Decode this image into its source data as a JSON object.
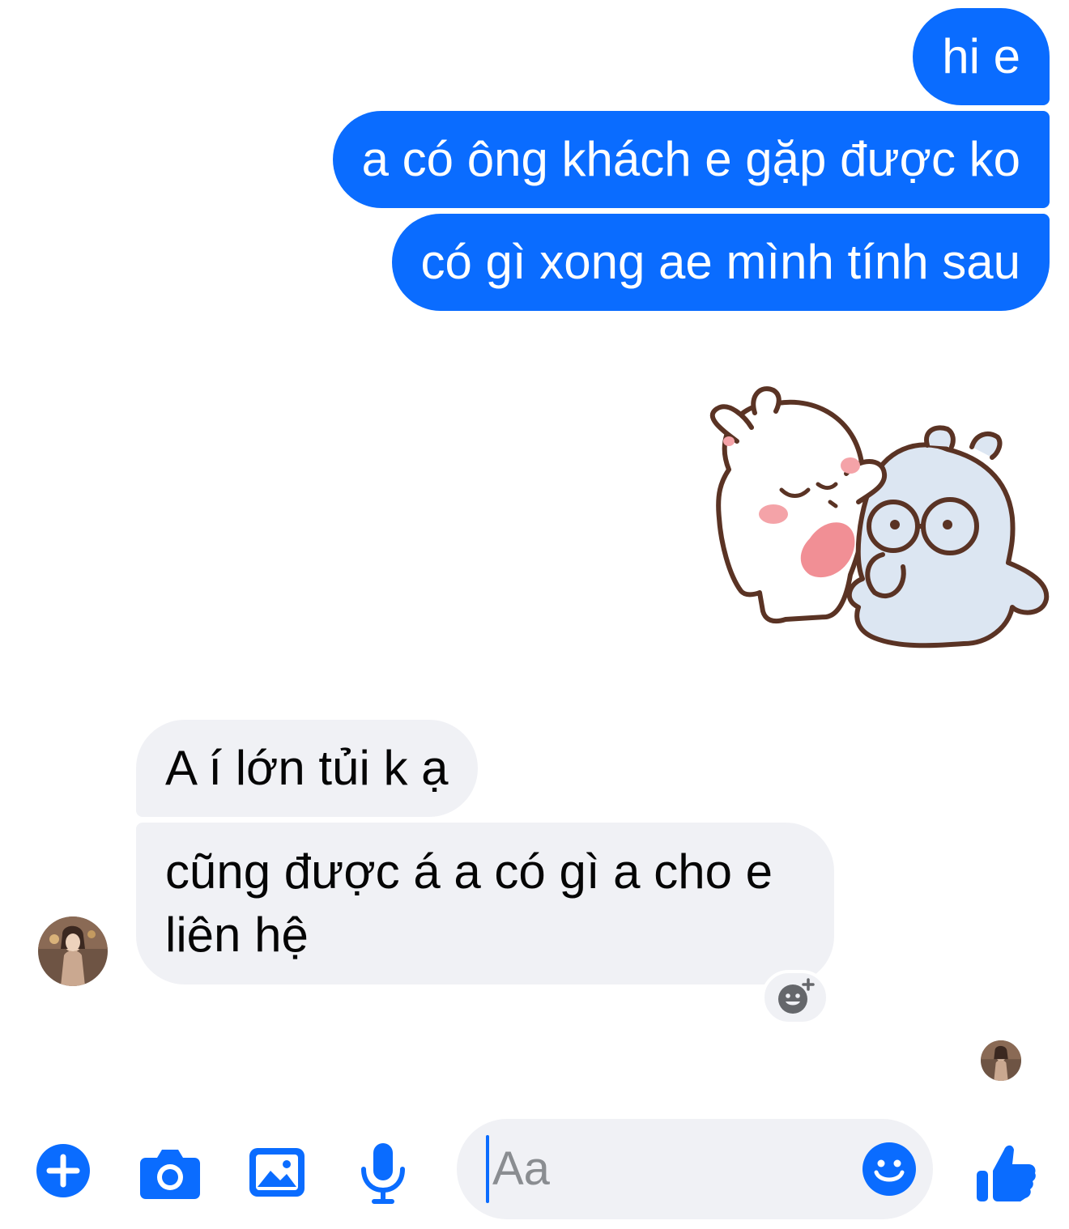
{
  "outgoing_messages": [
    {
      "text": "hi e"
    },
    {
      "text": "a có ông khách e gặp được ko"
    },
    {
      "text": "có gì xong ae mình tính sau"
    }
  ],
  "sticker": {
    "icon": "bear-hug-sticker"
  },
  "incoming_messages": [
    {
      "text": "A í lớn tủi k ạ"
    },
    {
      "text": "cũng được á a có gì a cho e liên hệ"
    }
  ],
  "composer": {
    "placeholder": "Aa",
    "icons": [
      "plus-icon",
      "camera-icon",
      "image-icon",
      "microphone-icon",
      "smile-icon",
      "thumbs-up-icon"
    ]
  },
  "colors": {
    "accent": "#0a6cff",
    "incoming_bubble": "#f0f1f5",
    "text_dark": "#050505"
  }
}
